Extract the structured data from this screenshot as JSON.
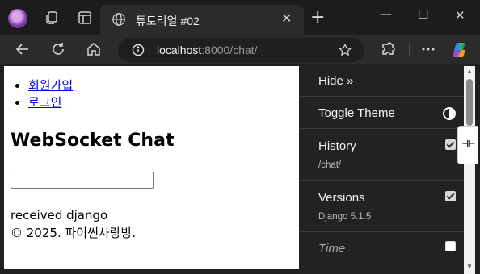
{
  "browser": {
    "tab_title": "튜토리얼 #02",
    "address": {
      "host": "localhost",
      "path": ":8000/chat/"
    }
  },
  "page": {
    "nav": [
      "회원가입",
      "로그인"
    ],
    "heading": "WebSocket Chat",
    "input_value": "",
    "received_text": "received django",
    "footer": "© 2025. 파이썬사랑방."
  },
  "debug_toolbar": {
    "hide_label": "Hide »",
    "toggle_theme_label": "Toggle Theme",
    "panels": [
      {
        "label": "History",
        "sub": "/chat/",
        "checked": true
      },
      {
        "label": "Versions",
        "sub": "Django 5.1.5",
        "checked": true
      },
      {
        "label": "Time",
        "sub": "",
        "checked": false
      }
    ],
    "handle_glyph": "⊣⊢"
  }
}
